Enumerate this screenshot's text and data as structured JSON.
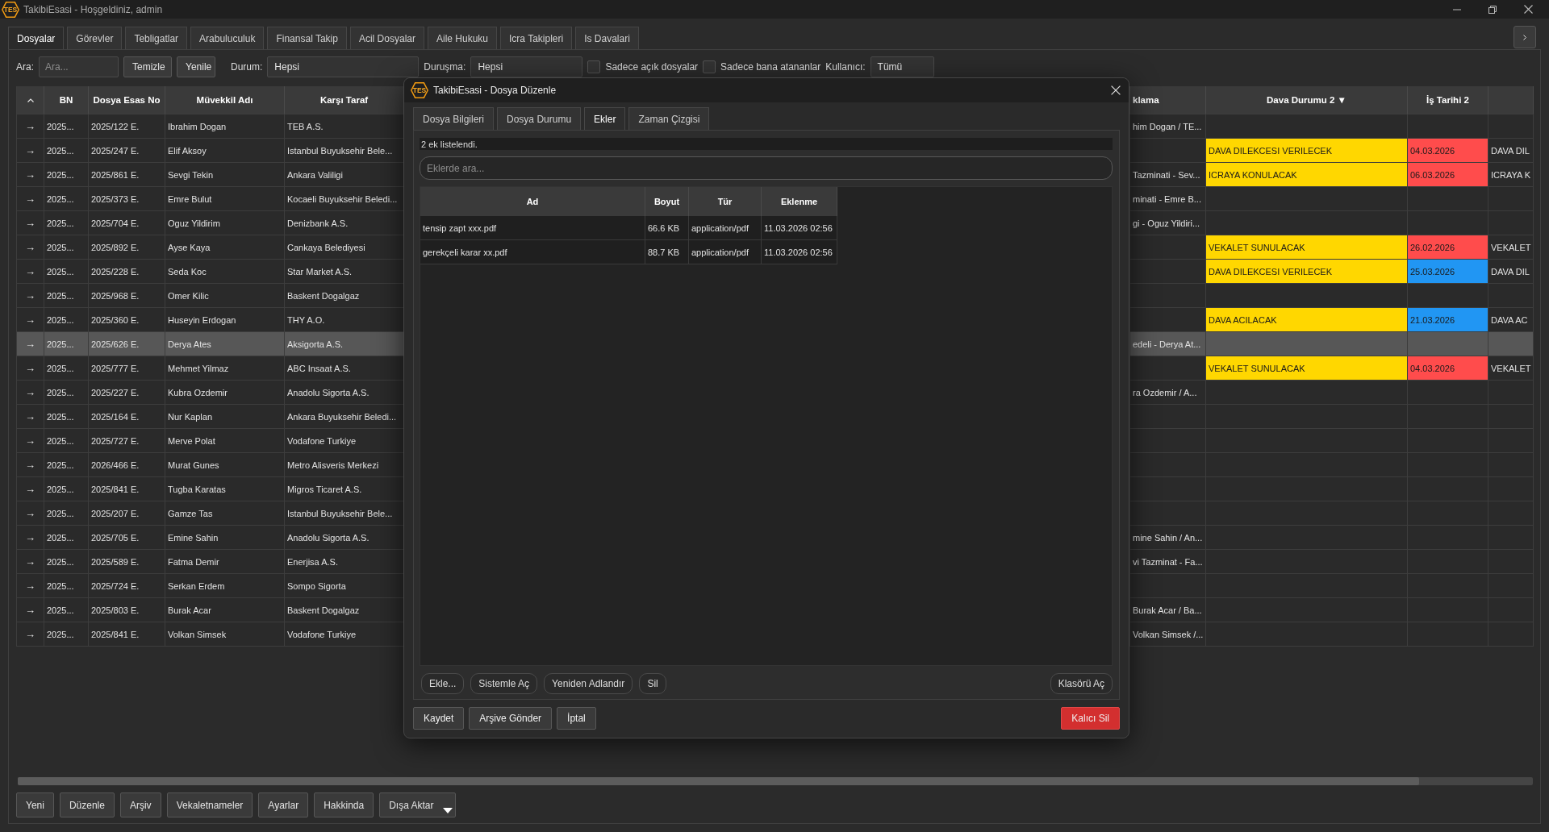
{
  "window": {
    "logo_text": "TES",
    "title": "TakibiEsasi - Hoşgeldiniz, admin"
  },
  "tabs": [
    {
      "label": "Dosyalar",
      "selected": true
    },
    {
      "label": "Görevler",
      "selected": false
    },
    {
      "label": "Tebligatlar",
      "selected": false
    },
    {
      "label": "Arabuluculuk",
      "selected": false
    },
    {
      "label": "Finansal Takip",
      "selected": false
    },
    {
      "label": "Acil Dosyalar",
      "selected": false
    },
    {
      "label": "Aile Hukuku",
      "selected": false
    },
    {
      "label": "Icra Takipleri",
      "selected": false
    },
    {
      "label": "Is Davalari",
      "selected": false
    }
  ],
  "filters": {
    "search": {
      "label": "Ara:",
      "placeholder": "Ara..."
    },
    "buttons": [
      "Temizle",
      "Yenile"
    ],
    "status": {
      "label": "Durum:",
      "value": "Hepsi"
    },
    "hearing": {
      "label": "Duruşma:",
      "value": "Hepsi"
    },
    "checkboxes": [
      {
        "label": "Sadece açık dosyalar",
        "checked": false
      },
      {
        "label": "Sadece bana atananlar",
        "checked": false
      }
    ],
    "user": {
      "label": "Kullanıcı:",
      "value": "Tümü"
    }
  },
  "table": {
    "columns": [
      "BN",
      "Dosya Esas No",
      "Müvekkil Adı",
      "Karşı Taraf",
      "klama",
      "Dava Durumu 2 ▼",
      "İş Tarihi 2"
    ],
    "rows": [
      {
        "selected": false,
        "marker": "→",
        "bn": "2025...",
        "esas_no": "2025/122 E.",
        "client": "Ibrahim Dogan",
        "opponent": "TEB A.S.",
        "column_6": "him Dogan / TE..."
      },
      {
        "selected": false,
        "marker": "→",
        "bn": "2025...",
        "esas_no": "2025/247 E.",
        "client": "Elif Aksoy",
        "opponent": "Istanbul Buyuksehir Bele...",
        "status_2": {
          "text": "DAVA DILEKCESI VERILECEK",
          "color": "#ffd700"
        },
        "work_date_2": {
          "text": "04.03.2026",
          "color": "#ff4c4c"
        },
        "column_9": "DAVA DIL"
      },
      {
        "selected": false,
        "marker": "→",
        "bn": "2025...",
        "esas_no": "2025/861 E.",
        "client": "Sevgi Tekin",
        "opponent": "Ankara Valiligi",
        "column_6": "Tazminati - Sev...",
        "status_2": {
          "text": "ICRAYA KONULACAK",
          "color": "#ffd700"
        },
        "work_date_2": {
          "text": "06.03.2026",
          "color": "#ff4c4c"
        },
        "column_9": "ICRAYA K"
      },
      {
        "selected": false,
        "marker": "→",
        "bn": "2025...",
        "esas_no": "2025/373 E.",
        "client": "Emre Bulut",
        "opponent": "Kocaeli Buyuksehir Beledi...",
        "column_6": "minati - Emre B..."
      },
      {
        "selected": false,
        "marker": "→",
        "bn": "2025...",
        "esas_no": "2025/704 E.",
        "client": "Oguz Yildirim",
        "opponent": "Denizbank A.S.",
        "column_6": "gi - Oguz Yildiri..."
      },
      {
        "selected": false,
        "marker": "→",
        "bn": "2025...",
        "esas_no": "2025/892 E.",
        "client": "Ayse Kaya",
        "opponent": "Cankaya Belediyesi",
        "status_2": {
          "text": "VEKALET SUNULACAK",
          "color": "#ffd700"
        },
        "work_date_2": {
          "text": "26.02.2026",
          "color": "#ff4c4c"
        },
        "column_9": "VEKALET"
      },
      {
        "selected": false,
        "marker": "→",
        "bn": "2025...",
        "esas_no": "2025/228 E.",
        "client": "Seda Koc",
        "opponent": "Star Market A.S.",
        "status_2": {
          "text": "DAVA DILEKCESI VERILECEK",
          "color": "#ffd700"
        },
        "work_date_2": {
          "text": "25.03.2026",
          "color": "#2196f3"
        },
        "column_9": "DAVA DIL"
      },
      {
        "selected": false,
        "marker": "→",
        "bn": "2025...",
        "esas_no": "2025/968 E.",
        "client": "Omer Kilic",
        "opponent": "Baskent Dogalgaz"
      },
      {
        "selected": false,
        "marker": "→",
        "bn": "2025...",
        "esas_no": "2025/360 E.",
        "client": "Huseyin Erdogan",
        "opponent": "THY A.O.",
        "status_2": {
          "text": "DAVA ACILACAK",
          "color": "#ffd700"
        },
        "work_date_2": {
          "text": "21.03.2026",
          "color": "#2196f3"
        },
        "column_9": "DAVA AC"
      },
      {
        "selected": true,
        "marker": "→",
        "bn": "2025...",
        "esas_no": "2025/626 E.",
        "client": "Derya Ates",
        "opponent": "Aksigorta A.S.",
        "column_6": "edeli - Derya At..."
      },
      {
        "selected": false,
        "marker": "→",
        "bn": "2025...",
        "esas_no": "2025/777 E.",
        "client": "Mehmet Yilmaz",
        "opponent": "ABC Insaat A.S.",
        "status_2": {
          "text": "VEKALET SUNULACAK",
          "color": "#ffd700"
        },
        "work_date_2": {
          "text": "04.03.2026",
          "color": "#ff4c4c"
        },
        "column_9": "VEKALET"
      },
      {
        "selected": false,
        "marker": "→",
        "bn": "2025...",
        "esas_no": "2025/227 E.",
        "client": "Kubra Ozdemir",
        "opponent": "Anadolu Sigorta A.S.",
        "column_6": "ra Ozdemir / A..."
      },
      {
        "selected": false,
        "marker": "→",
        "bn": "2025...",
        "esas_no": "2025/164 E.",
        "client": "Nur Kaplan",
        "opponent": "Ankara Buyuksehir Beledi..."
      },
      {
        "selected": false,
        "marker": "→",
        "bn": "2025...",
        "esas_no": "2025/727 E.",
        "client": "Merve Polat",
        "opponent": "Vodafone Turkiye"
      },
      {
        "selected": false,
        "marker": "→",
        "bn": "2025...",
        "esas_no": "2026/466 E.",
        "client": "Murat Gunes",
        "opponent": "Metro Alisveris Merkezi"
      },
      {
        "selected": false,
        "marker": "→",
        "bn": "2025...",
        "esas_no": "2025/841 E.",
        "client": "Tugba Karatas",
        "opponent": "Migros Ticaret A.S."
      },
      {
        "selected": false,
        "marker": "→",
        "bn": "2025...",
        "esas_no": "2025/207 E.",
        "client": "Gamze Tas",
        "opponent": "Istanbul Buyuksehir Bele..."
      },
      {
        "selected": false,
        "marker": "→",
        "bn": "2025...",
        "esas_no": "2025/705 E.",
        "client": "Emine Sahin",
        "opponent": "Anadolu Sigorta A.S.",
        "column_6": "mine Sahin / An..."
      },
      {
        "selected": false,
        "marker": "→",
        "bn": "2025...",
        "esas_no": "2025/589 E.",
        "client": "Fatma Demir",
        "opponent": "Enerjisa A.S.",
        "column_6": "vi Tazminat - Fa..."
      },
      {
        "selected": false,
        "marker": "→",
        "bn": "2025...",
        "esas_no": "2025/724 E.",
        "client": "Serkan Erdem",
        "opponent": "Sompo Sigorta"
      },
      {
        "selected": false,
        "marker": "→",
        "bn": "2025...",
        "esas_no": "2025/803 E.",
        "client": "Burak Acar",
        "opponent": "Baskent Dogalgaz",
        "column_6": "Burak Acar / Ba..."
      },
      {
        "selected": false,
        "marker": "→",
        "bn": "2025...",
        "esas_no": "2025/841 E.",
        "client": "Volkan Simsek",
        "opponent": "Vodafone Turkiye",
        "column_6": "Volkan Simsek /..."
      }
    ]
  },
  "actions": [
    "Yeni",
    "Düzenle",
    "Arşiv",
    "Vekaletnameler",
    "Ayarlar",
    "Hakkinda",
    "Dışa Aktar"
  ],
  "dialog": {
    "logo_text": "TES",
    "title": "TakibiEsasi - Dosya Düzenle",
    "tabs": [
      {
        "label": "Dosya Bilgileri",
        "selected": false
      },
      {
        "label": "Dosya Durumu",
        "selected": false
      },
      {
        "label": "Ekler",
        "selected": true
      },
      {
        "label": "Zaman Çizgisi",
        "selected": false
      }
    ],
    "status": "2 ek listelendi.",
    "search_placeholder": "Eklerde ara...",
    "attachments": {
      "columns": [
        "Ad",
        "Boyut",
        "Tür",
        "Eklenme"
      ],
      "rows": [
        {
          "name": "tensip zapt xxx.pdf",
          "size": "66.6 KB",
          "type": "application/pdf",
          "added": "11.03.2026 02:56"
        },
        {
          "name": "gerekçeli karar xx.pdf",
          "size": "88.7 KB",
          "type": "application/pdf",
          "added": "11.03.2026 02:56"
        }
      ]
    },
    "file_buttons": [
      "Ekle...",
      "Sistemle Aç",
      "Yeniden Adlandır",
      "Sil"
    ],
    "folder_button": "Klasörü Aç",
    "footer_buttons": [
      {
        "label": "Kaydet",
        "kind": "normal"
      },
      {
        "label": "Arşive Gönder",
        "kind": "normal"
      },
      {
        "label": "İptal",
        "kind": "normal"
      },
      {
        "label": "Kalıcı Sil",
        "kind": "danger"
      }
    ]
  }
}
